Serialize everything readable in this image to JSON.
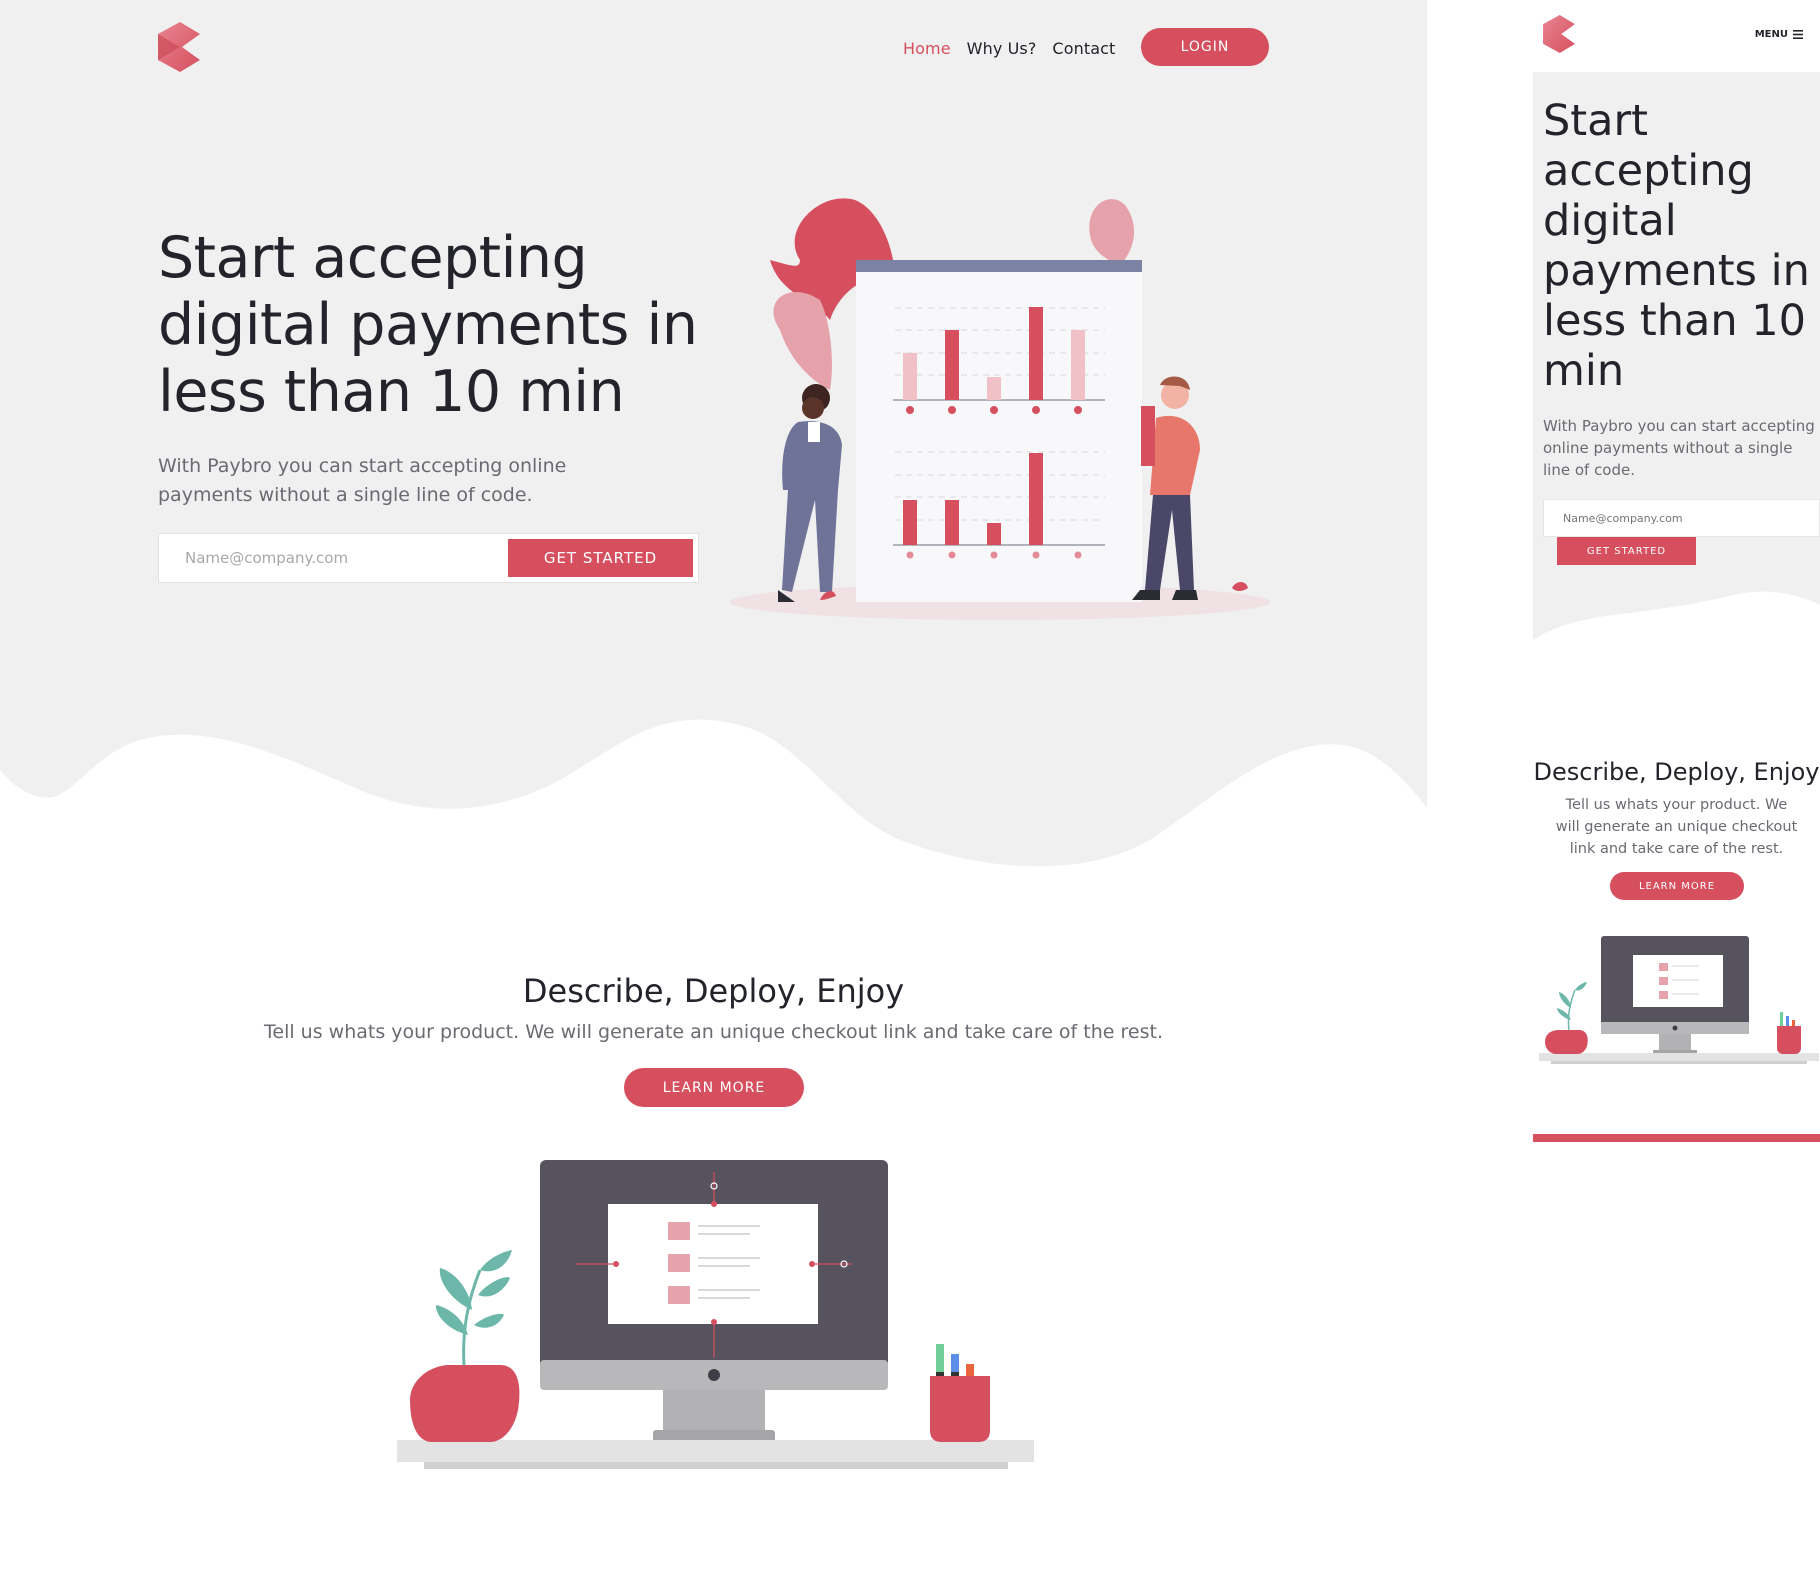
{
  "colors": {
    "accent": "#d64f5e",
    "hero_bg": "#f0f0f0",
    "text": "#23232b",
    "muted": "#6a6a72"
  },
  "desktop": {
    "nav": {
      "home": "Home",
      "why_us": "Why Us?",
      "contact": "Contact",
      "login": "LOGIN"
    },
    "hero": {
      "title": "Start accepting digital payments in less than 10 min",
      "subtitle": "With Paybro you can start accepting online payments without a single line of code.",
      "email_placeholder": "Name@company.com",
      "cta": "GET STARTED"
    },
    "section": {
      "title": "Describe, Deploy, Enjoy",
      "subtitle": "Tell us whats your product. We will generate an unique checkout link and take care of the rest.",
      "cta": "LEARN MORE"
    }
  },
  "mobile": {
    "menu_label": "MENU",
    "menu_icon": "hamburger-icon",
    "hero": {
      "title": "Start accepting digital payments in less than 10 min",
      "subtitle": "With Paybro you can start accepting online payments without a single line of code.",
      "email_placeholder": "Name@company.com",
      "cta": "GET STARTED"
    },
    "section": {
      "title": "Describe, Deploy, Enjoy",
      "subtitle": "Tell us whats your product. We will generate an unique checkout link and take care of the rest.",
      "cta": "LEARN MORE"
    }
  }
}
